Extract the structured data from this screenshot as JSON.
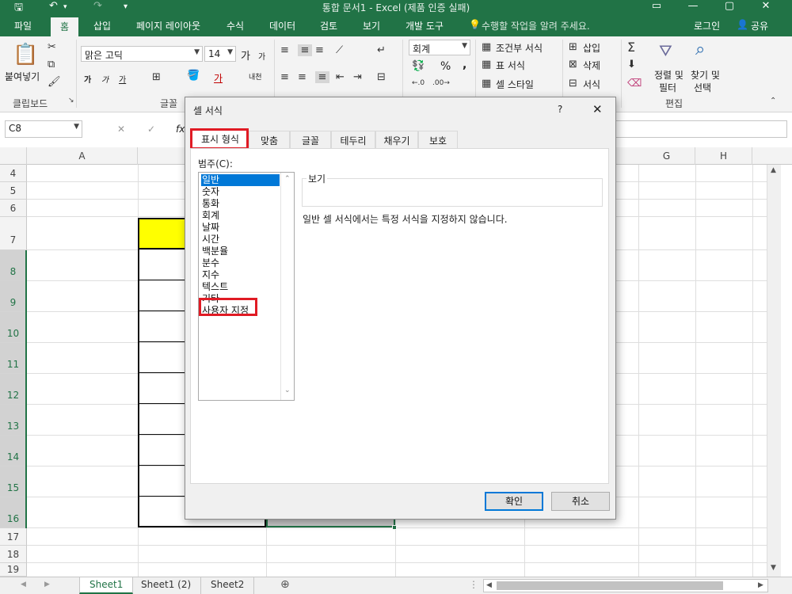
{
  "window": {
    "title": "통합 문서1 - Excel (제품 인증 실패)"
  },
  "ribbon_tabs": [
    "파일",
    "홈",
    "삽입",
    "페이지 레이아웃",
    "수식",
    "데이터",
    "검토",
    "보기",
    "개발 도구"
  ],
  "tell_me": "수행할 작업을 알려 주세요.",
  "login": "로그인",
  "share": "공유",
  "clipboard": {
    "paste": "붙여넣기",
    "group": "클립보드"
  },
  "font": {
    "name": "맑은 고딕",
    "size": "14",
    "group": "글꼴",
    "bold": "가",
    "italic": "가",
    "underline": "가",
    "grow": "가",
    "shrink": "가",
    "color": "가",
    "phonetic": "내천"
  },
  "number": {
    "format": "회계",
    "percent": "%",
    "comma": ","
  },
  "styles": {
    "conditional": "조건부 서식",
    "table": "표 서식",
    "cell": "셀 스타일"
  },
  "cells": {
    "insert": "삽입",
    "delete": "삭제",
    "format": "서식"
  },
  "editing": {
    "sort": "정렬 및",
    "sort2": "필터",
    "find": "찾기 및",
    "find2": "선택",
    "group": "편집"
  },
  "formula_bar": {
    "name_box": "C8",
    "fx": "fx"
  },
  "columns": [
    "A",
    "G",
    "H"
  ],
  "rows": [
    "4",
    "5",
    "6",
    "7",
    "8",
    "9",
    "10",
    "11",
    "12",
    "13",
    "14",
    "15",
    "16",
    "17",
    "18",
    "19"
  ],
  "sheets": [
    "Sheet1",
    "Sheet1 (2)",
    "Sheet2"
  ],
  "dialog": {
    "title": "셀 서식",
    "help": "?",
    "close": "✕",
    "tabs": [
      "표시 형식",
      "맞춤",
      "글꼴",
      "테두리",
      "채우기",
      "보호"
    ],
    "category_label": "범주(C):",
    "categories": [
      "일반",
      "숫자",
      "통화",
      "회계",
      "날짜",
      "시간",
      "백분율",
      "분수",
      "지수",
      "텍스트",
      "기타",
      "사용자 지정"
    ],
    "selected_category": "일반",
    "sample_label": "보기",
    "description": "일반 셀 서식에서는 특정 서식을 지정하지 않습니다.",
    "ok": "확인",
    "cancel": "취소"
  },
  "colors": {
    "excel_green": "#217346",
    "highlight_yellow": "#ffff00",
    "select_blue": "#0078d7",
    "annotation_red": "#e01b24"
  }
}
